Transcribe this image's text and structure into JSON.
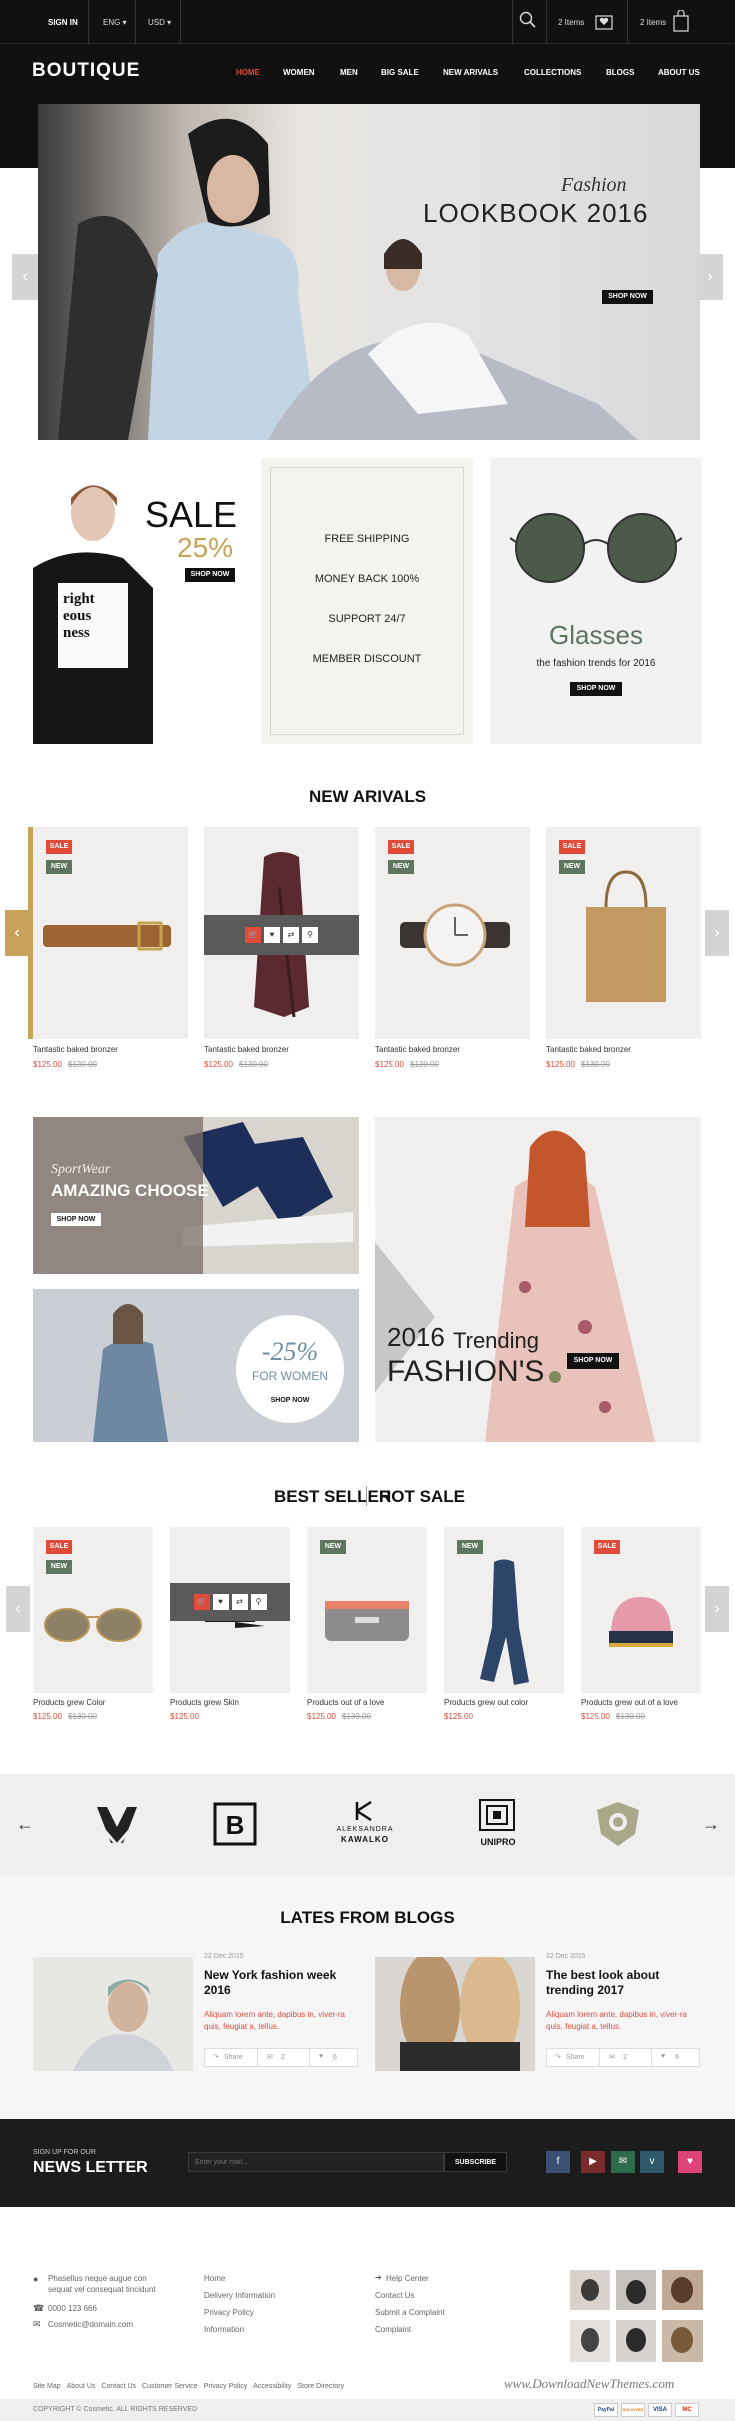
{
  "header": {
    "sign_in": "SIGN IN",
    "lang": "ENG ▾",
    "currency": "USD ▾",
    "wishlist_count": "2 Items",
    "cart_count": "2 Items"
  },
  "logo": "BOUTIQUE",
  "nav": [
    "HOME",
    "WOMEN",
    "MEN",
    "BIG SALE",
    "NEW ARIVALS",
    "COLLECTIONS",
    "BLOGS",
    "ABOUT US"
  ],
  "hero": {
    "script": "Fashion",
    "title": "LOOKBOOK 2016",
    "button": "SHOP NOW"
  },
  "promo": {
    "sale_title": "SALE",
    "sale_pct": "25%",
    "sale_button": "SHOP NOW",
    "shirt_text": [
      "right",
      "eous",
      "ness"
    ],
    "features": [
      "FREE SHIPPING",
      "MONEY BACK 100%",
      "SUPPORT 24/7",
      "MEMBER DISCOUNT"
    ],
    "glasses_title": "Glasses",
    "glasses_sub": "the fashion trends for 2016",
    "glasses_button": "SHOP NOW"
  },
  "new_arrivals": {
    "title": "NEW ARIVALS",
    "products": [
      {
        "name": "Tantastic baked bronzer",
        "price": "$125.00",
        "old": "$130.00",
        "sale": "SALE",
        "new": "NEW"
      },
      {
        "name": "Tantastic baked bronzer",
        "price": "$125.00",
        "old": "$130.00"
      },
      {
        "name": "Tantastic baked bronzer",
        "price": "$125.00",
        "old": "$130.00",
        "sale": "SALE",
        "new": "NEW"
      },
      {
        "name": "Tantastic baked bronzer",
        "price": "$125.00",
        "old": "$130.00",
        "sale": "SALE",
        "new": "NEW"
      }
    ]
  },
  "banners": {
    "sport_script": "SportWear",
    "sport_title": "AMAZING CHOOSE",
    "sport_button": "SHOP NOW",
    "women_pct": "-25%",
    "women_label": "FOR WOMEN",
    "women_button": "SHOP NOW",
    "trend_year": "2016",
    "trend_word": "Trending",
    "trend_title": "FASHION'S",
    "trend_button": "SHOP NOW"
  },
  "best": {
    "tab1": "BEST SELLER",
    "tab2": "HOT SALE",
    "products": [
      {
        "name": "Products grew Color",
        "price": "$125.00",
        "old": "$130.00",
        "sale": "SALE",
        "new": "NEW"
      },
      {
        "name": "Products grew Skin",
        "price": "$125.00"
      },
      {
        "name": "Products out of a love",
        "price": "$125.00",
        "old": "$130.00",
        "new": "NEW"
      },
      {
        "name": "Products grew out color",
        "price": "$125.00",
        "new": "NEW"
      },
      {
        "name": "Products grew out of a love",
        "price": "$125.00",
        "old": "$130.00",
        "sale": "SALE"
      }
    ]
  },
  "brands": {
    "b3_line1": "ALEKSANDRA",
    "b3_line2": "KAWALKO",
    "b4": "UNIPRO"
  },
  "blogs": {
    "title": "LATES FROM BLOGS",
    "posts": [
      {
        "date": "22 Dec 2015",
        "title": "New York fashion week 2016",
        "excerpt": "Aliquam lorem ante, dapibus in, viver-ra quis, feugiat a, tellus.",
        "share": "Share",
        "comments": "2",
        "likes": "6"
      },
      {
        "date": "22 Dec 2015",
        "title": "The best look about trending 2017",
        "excerpt": "Aliquam lorem ante, dapibus in, viver-ra quis, feugiat a, tellus.",
        "share": "Share",
        "comments": "2",
        "likes": "6"
      }
    ]
  },
  "newsletter": {
    "small": "SIGN UP FOR OUR",
    "big": "NEWS LETTER",
    "placeholder": "Enter your mail...",
    "button": "SUBSCRIBE"
  },
  "footer": {
    "address1": "Phasellus neque augue con",
    "address2": "sequat vel consequat tincidunt",
    "phone": "0000 123 666",
    "email": "Cosmetic@domain.com",
    "col2": [
      "Home",
      "Delivery Information",
      "Privacy Policy",
      "Information"
    ],
    "col3": [
      "Help Center",
      "Contact Us",
      "Submit a Complaint",
      "Complaint"
    ],
    "bottom_links": [
      "Site Map",
      "About Us",
      "Contact Us",
      "Customer Service",
      "Privacy Policy",
      "Accessibility",
      "Store Directory"
    ],
    "copyright": "COPYRIGHT © Cosmetic. ALL RIGHTS RESERVED",
    "watermark": "www.DownloadNewThemes.com",
    "payments": [
      "PayPal",
      "DISCOVER",
      "VISA",
      "MC"
    ]
  }
}
